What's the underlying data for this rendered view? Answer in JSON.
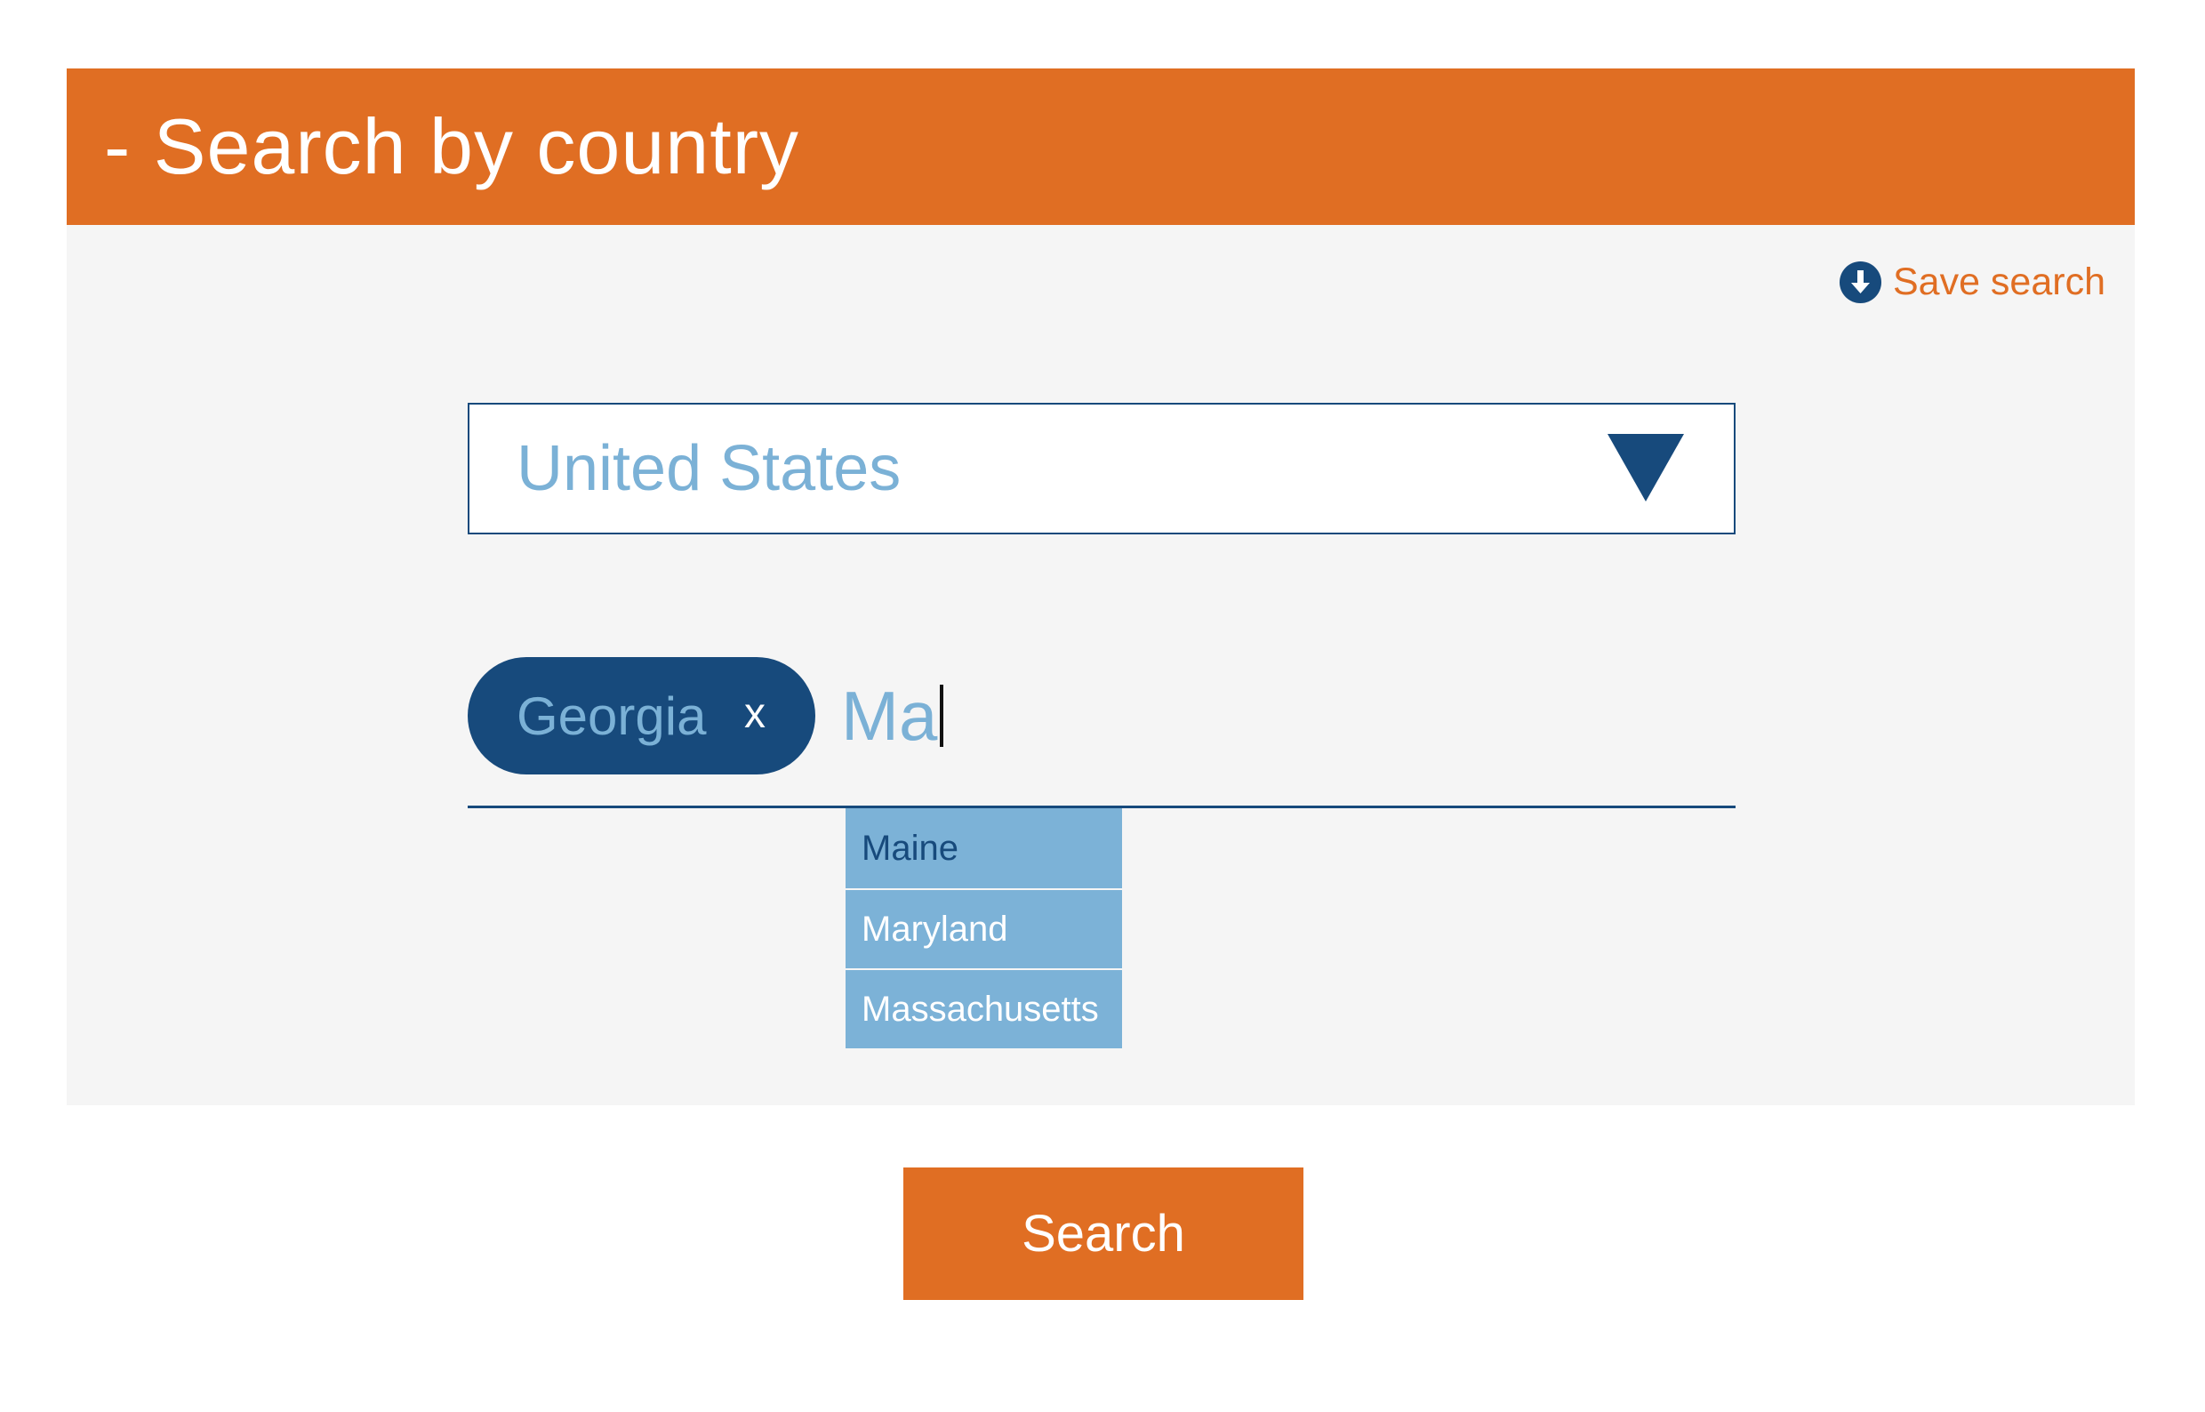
{
  "header": {
    "title": "- Search by country"
  },
  "toolbar": {
    "save_label": "Save search",
    "save_icon": "download-circle-icon"
  },
  "country_select": {
    "selected_value": "United States",
    "arrow_icon": "triangle-down-icon"
  },
  "state_field": {
    "chips": [
      {
        "label": "Georgia",
        "remove_label": "x"
      }
    ],
    "typed_value": "Ma"
  },
  "suggestions": [
    {
      "label": "Maine"
    },
    {
      "label": "Maryland"
    },
    {
      "label": "Massachusetts"
    }
  ],
  "actions": {
    "search_label": "Search"
  },
  "colors": {
    "accent_orange": "#e06e23",
    "primary_blue": "#174a7c",
    "light_blue": "#7bb1d6",
    "panel_background": "#f5f5f5"
  }
}
